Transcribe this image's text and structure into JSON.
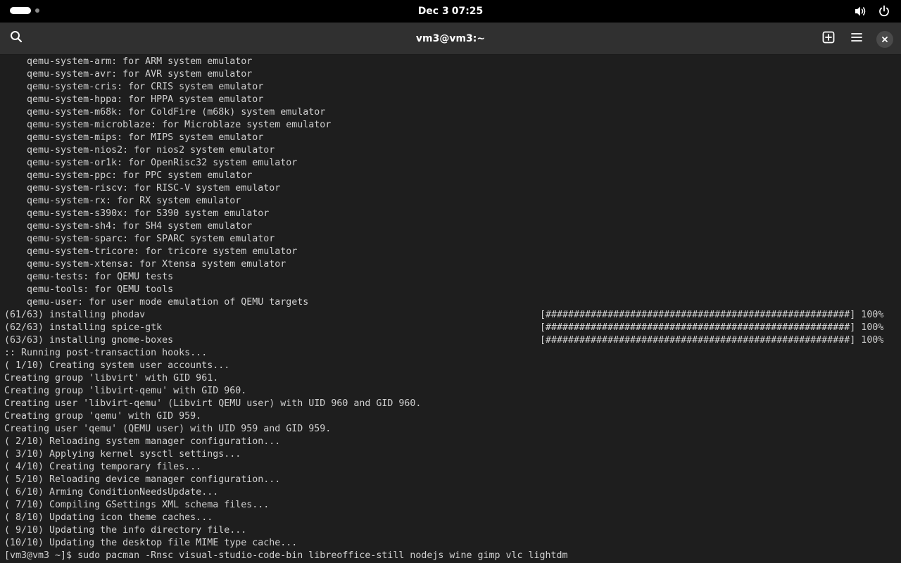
{
  "topbar": {
    "date": "Dec 3",
    "time": "07:25",
    "icons": [
      "activities-indicator",
      "volume-icon",
      "power-icon"
    ]
  },
  "headerbar": {
    "title": "vm3@vm3:~",
    "icons": [
      "search-icon",
      "new-tab-icon",
      "menu-icon",
      "close-icon"
    ]
  },
  "terminal": {
    "colors": {
      "background": "#1e1e1e",
      "foreground": "#d0d0d0"
    },
    "lines": [
      {
        "text": "    qemu-system-arm: for ARM system emulator"
      },
      {
        "text": "    qemu-system-avr: for AVR system emulator"
      },
      {
        "text": "    qemu-system-cris: for CRIS system emulator"
      },
      {
        "text": "    qemu-system-hppa: for HPPA system emulator"
      },
      {
        "text": "    qemu-system-m68k: for ColdFire (m68k) system emulator"
      },
      {
        "text": "    qemu-system-microblaze: for Microblaze system emulator"
      },
      {
        "text": "    qemu-system-mips: for MIPS system emulator"
      },
      {
        "text": "    qemu-system-nios2: for nios2 system emulator"
      },
      {
        "text": "    qemu-system-or1k: for OpenRisc32 system emulator"
      },
      {
        "text": "    qemu-system-ppc: for PPC system emulator"
      },
      {
        "text": "    qemu-system-riscv: for RISC-V system emulator"
      },
      {
        "text": "    qemu-system-rx: for RX system emulator"
      },
      {
        "text": "    qemu-system-s390x: for S390 system emulator"
      },
      {
        "text": "    qemu-system-sh4: for SH4 system emulator"
      },
      {
        "text": "    qemu-system-sparc: for SPARC system emulator"
      },
      {
        "text": "    qemu-system-tricore: for tricore system emulator"
      },
      {
        "text": "    qemu-system-xtensa: for Xtensa system emulator"
      },
      {
        "text": "    qemu-tests: for QEMU tests"
      },
      {
        "text": "    qemu-tools: for QEMU tools"
      },
      {
        "text": "    qemu-user: for user mode emulation of QEMU targets"
      },
      {
        "text": "(61/63) installing phodav",
        "progress": "[######################################################] 100%"
      },
      {
        "text": "(62/63) installing spice-gtk",
        "progress": "[######################################################] 100%"
      },
      {
        "text": "(63/63) installing gnome-boxes",
        "progress": "[######################################################] 100%"
      },
      {
        "text": ":: Running post-transaction hooks..."
      },
      {
        "text": "( 1/10) Creating system user accounts..."
      },
      {
        "text": "Creating group 'libvirt' with GID 961."
      },
      {
        "text": "Creating group 'libvirt-qemu' with GID 960."
      },
      {
        "text": "Creating user 'libvirt-qemu' (Libvirt QEMU user) with UID 960 and GID 960."
      },
      {
        "text": "Creating group 'qemu' with GID 959."
      },
      {
        "text": "Creating user 'qemu' (QEMU user) with UID 959 and GID 959."
      },
      {
        "text": "( 2/10) Reloading system manager configuration..."
      },
      {
        "text": "( 3/10) Applying kernel sysctl settings..."
      },
      {
        "text": "( 4/10) Creating temporary files..."
      },
      {
        "text": "( 5/10) Reloading device manager configuration..."
      },
      {
        "text": "( 6/10) Arming ConditionNeedsUpdate..."
      },
      {
        "text": "( 7/10) Compiling GSettings XML schema files..."
      },
      {
        "text": "( 8/10) Updating icon theme caches..."
      },
      {
        "text": "( 9/10) Updating the info directory file..."
      },
      {
        "text": "(10/10) Updating the desktop file MIME type cache..."
      },
      {
        "text": "[vm3@vm3 ~]$ sudo pacman -Rnsc visual-studio-code-bin libreoffice-still nodejs wine gimp vlc lightdm"
      }
    ]
  }
}
